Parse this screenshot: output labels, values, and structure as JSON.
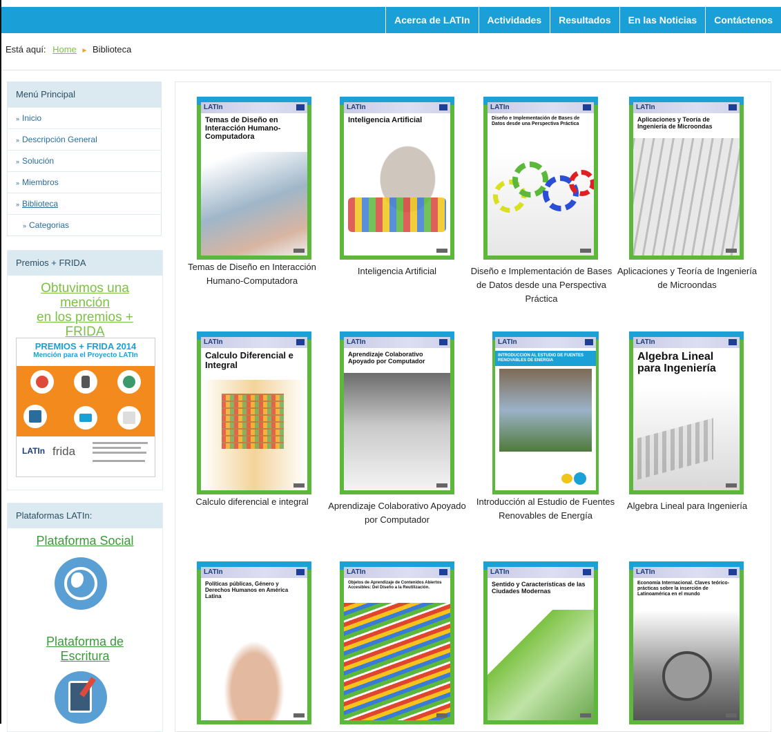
{
  "nav": {
    "items": [
      "Acerca de LATIn",
      "Actividades",
      "Resultados",
      "En las Noticias",
      "Contáctenos"
    ]
  },
  "breadcrumb": {
    "label": "Está aquí:",
    "home": "Home",
    "current": "Biblioteca"
  },
  "menu": {
    "title": "Menú Principal",
    "items": [
      {
        "label": "Inicio"
      },
      {
        "label": "Descripción General"
      },
      {
        "label": "Solución"
      },
      {
        "label": "Miembros"
      },
      {
        "label": "Biblioteca"
      },
      {
        "label": "Categorias"
      }
    ]
  },
  "premios": {
    "title": "Premios + FRIDA",
    "link_lines": [
      "Obtuvimos una",
      "mención",
      "en los premios +",
      "FRIDA"
    ],
    "poster_title": "PREMIOS + FRIDA 2014",
    "poster_sub": "Mención para el Proyecto LATIn",
    "poster_latin": "LATIn",
    "poster_frida": "frida"
  },
  "platforms": {
    "title": "Plataformas LATIn:",
    "social": "Plataforma Social",
    "writing_lines": [
      "Plataforma de",
      "Escritura"
    ]
  },
  "book_logo": "LATIn",
  "books": [
    {
      "cover": "Temas de Diseño en Interacción Humano-Computadora",
      "caption": "Temas de Diseño en Interacción Humano-Computadora"
    },
    {
      "cover": "Inteligencia Artificial",
      "caption": "Inteligencia Artificial"
    },
    {
      "cover": "Diseño e Implementación de Bases de Datos desde una Perspectiva Práctica",
      "caption": "Diseño e Implementación de Bases de Datos desde una Perspectiva Práctica"
    },
    {
      "cover": "Aplicaciones y Teoría de Ingeniería de Microondas",
      "caption": "Aplicaciones y Teoría de Ingeniería de Microondas"
    },
    {
      "cover": "Calculo Diferencial e Integral",
      "caption": "Calculo diferencial e integral"
    },
    {
      "cover": "Aprendizaje Colaborativo Apoyado por Computador",
      "caption": "Aprendizaje Colaborativo Apoyado por Computador"
    },
    {
      "cover": "INTRODUCCION AL ESTUDIO DE FUENTES RENOVABLES DE ENERGIA",
      "caption": "Introducción al Estudio de Fuentes Renovables de Energía"
    },
    {
      "cover": "Algebra Lineal para Ingeniería",
      "caption": "Algebra Lineal para Ingeniería"
    },
    {
      "cover": "Políticas públicas, Género y Derechos Humanos en América Latina",
      "caption": ""
    },
    {
      "cover": "Objetos de Aprendizaje de Contenidos Abiertos Accesibles: Del Diseño a la Reutilización.",
      "caption": ""
    },
    {
      "cover": "Sentido y Características de las Ciudades Modernas",
      "caption": ""
    },
    {
      "cover": "Economía Internacional. Claves teórico-prácticas sobre la inserción de Latinoamérica en el mundo",
      "caption": ""
    }
  ]
}
